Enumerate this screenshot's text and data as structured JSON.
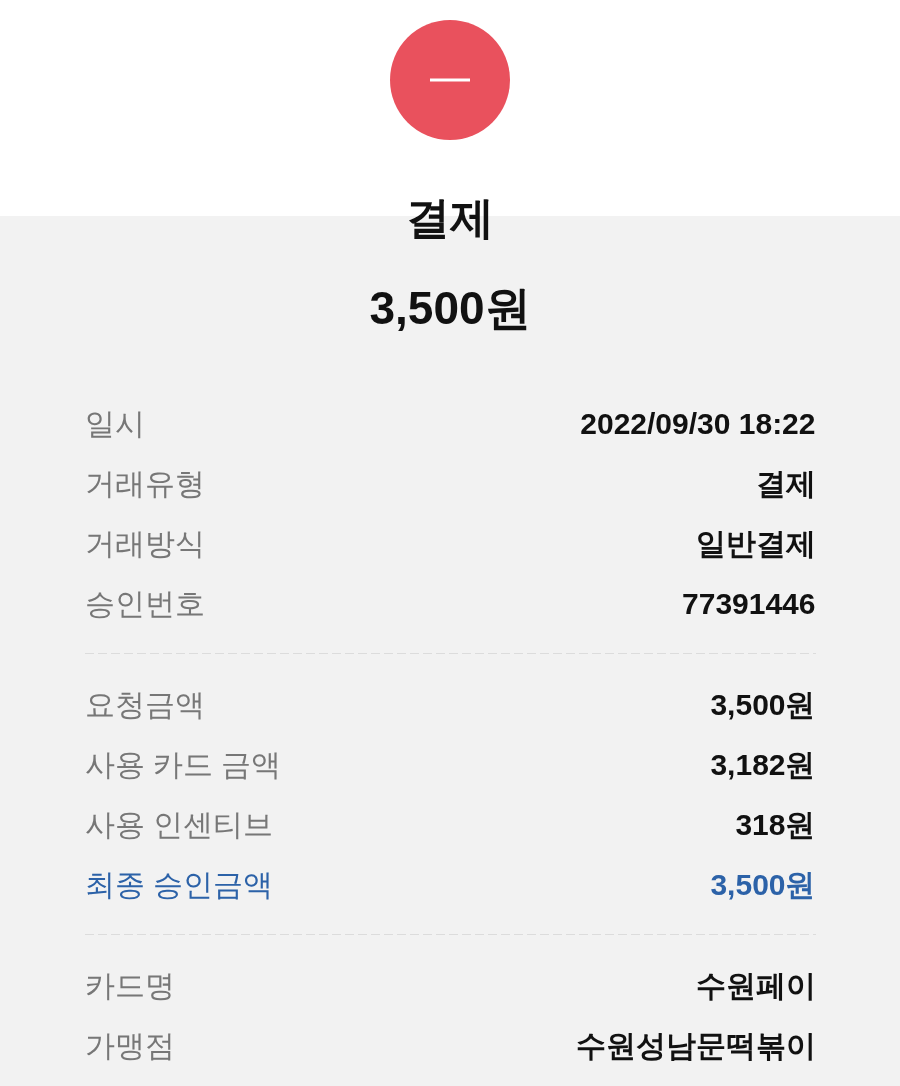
{
  "header": {
    "title": "결제",
    "amount": "3,500원"
  },
  "sections": [
    {
      "rows": [
        {
          "label": "일시",
          "value": "2022/09/30 18:22",
          "highlighted": false
        },
        {
          "label": "거래유형",
          "value": "결제",
          "highlighted": false
        },
        {
          "label": "거래방식",
          "value": "일반결제",
          "highlighted": false
        },
        {
          "label": "승인번호",
          "value": "77391446",
          "highlighted": false
        }
      ]
    },
    {
      "rows": [
        {
          "label": "요청금액",
          "value": "3,500원",
          "highlighted": false
        },
        {
          "label": "사용 카드 금액",
          "value": "3,182원",
          "highlighted": false
        },
        {
          "label": "사용 인센티브",
          "value": "318원",
          "highlighted": false
        },
        {
          "label": "최종 승인금액",
          "value": "3,500원",
          "highlighted": true
        }
      ]
    },
    {
      "rows": [
        {
          "label": "카드명",
          "value": "수원페이",
          "highlighted": false
        },
        {
          "label": "가맹점",
          "value": "수원성남문떡볶이",
          "highlighted": false
        }
      ]
    }
  ]
}
